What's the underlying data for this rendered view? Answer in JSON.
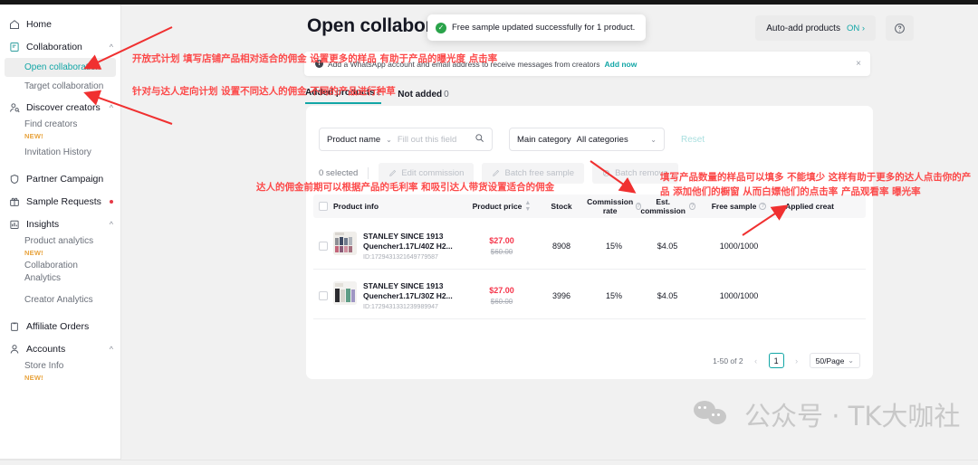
{
  "window": {
    "title": "Open collaboration"
  },
  "sidebar": {
    "items": [
      {
        "label": "Home",
        "icon": "home-icon",
        "type": "top"
      },
      {
        "label": "Collaboration",
        "icon": "collaboration-icon",
        "type": "top",
        "chevron": "^"
      },
      {
        "label": "Open collaboration",
        "type": "sub",
        "active": true
      },
      {
        "label": "Target collaboration",
        "type": "sub"
      },
      {
        "label": "Discover creators",
        "icon": "discover-creators-icon",
        "type": "top",
        "chevron": "^"
      },
      {
        "label": "Find creators",
        "type": "sub",
        "tag": "NEW!"
      },
      {
        "label": "Invitation History",
        "type": "sub"
      },
      {
        "label": "Partner Campaign",
        "icon": "shield-icon",
        "type": "top"
      },
      {
        "label": "Sample Requests",
        "icon": "gift-icon",
        "type": "top",
        "dot": true
      },
      {
        "label": "Insights",
        "icon": "insights-icon",
        "type": "top",
        "chevron": "^"
      },
      {
        "label": "Product analytics",
        "type": "sub",
        "tag": "NEW!"
      },
      {
        "label": "Collaboration Analytics",
        "type": "sub"
      },
      {
        "label": "Creator Analytics",
        "type": "sub"
      },
      {
        "label": "Affiliate Orders",
        "icon": "clipboard-icon",
        "type": "top"
      },
      {
        "label": "Accounts",
        "icon": "account-icon",
        "type": "top",
        "chevron": "^"
      },
      {
        "label": "Store Info",
        "type": "sub",
        "tag": "NEW!"
      }
    ]
  },
  "header": {
    "page_title": "Open collaborat",
    "toast": {
      "message": "Free sample updated successfully for 1 product.",
      "icon": "check-circle-icon"
    },
    "auto_add_label": "Auto-add products",
    "auto_add_state": "ON ›",
    "help_icon": "help-icon"
  },
  "banner": {
    "icon": "info-icon",
    "text": "Add a WhatsApp account and email address to receive messages from creators",
    "link": "Add now",
    "close": "×"
  },
  "tabs": [
    {
      "label": "Added products",
      "count": "2",
      "active": true
    },
    {
      "label": "Not added",
      "count": "0",
      "active": false
    }
  ],
  "filters": {
    "product_name_label": "Product name",
    "product_name_chevron": "⌄",
    "product_name_placeholder": "Fill out this field",
    "search_icon": "search-icon",
    "main_category_label": "Main category",
    "main_category_value": "All categories",
    "main_category_chevron": "⌄",
    "reset_label": "Reset"
  },
  "batch_bar": {
    "selected_label": "0 selected",
    "buttons": [
      {
        "label": "Edit commission",
        "icon": "edit-icon"
      },
      {
        "label": "Batch free sample",
        "icon": "edit-icon"
      },
      {
        "label": "Batch remove",
        "icon": "ban-icon"
      }
    ]
  },
  "table": {
    "columns": [
      {
        "label": "Product info"
      },
      {
        "label": "Product price",
        "sortable": true
      },
      {
        "label": "Stock"
      },
      {
        "label": "Commission rate",
        "info": true
      },
      {
        "label": "Est. commission",
        "info": true
      },
      {
        "label": "Free sample",
        "info": true
      },
      {
        "label": "Applied creat"
      }
    ],
    "rows": [
      {
        "name": "STANLEY SINCE 1913 Quencher1.17L/40Z H2...",
        "id": "ID:1729431321649779587",
        "price": "$27.00",
        "price_old": "$60.00",
        "stock": "8908",
        "commission_rate": "15%",
        "est_commission": "$4.05",
        "free_sample": "1000/1000"
      },
      {
        "name": "STANLEY SINCE 1913 Quencher1.17L/30Z H2...",
        "id": "ID:1729431331239989947",
        "price": "$27.00",
        "price_old": "$60.00",
        "stock": "3996",
        "commission_rate": "15%",
        "est_commission": "$4.05",
        "free_sample": "1000/1000"
      }
    ]
  },
  "pagination": {
    "range": "1-50 of 2",
    "prev": "‹",
    "current_page": "1",
    "next": "›",
    "page_size": "50/Page",
    "page_size_chevron": "⌄"
  },
  "annotations": [
    {
      "id": "anno-open-plan",
      "text": "开放式计划 填写店铺产品相对适合的佣金 设置更多的样品 有助于产品的曝光度 点击率"
    },
    {
      "id": "anno-target-plan",
      "text": "针对与达人定向计划 设置不同达人的佣金 不同的产品进行种草"
    },
    {
      "id": "anno-commission",
      "text": "达人的佣金前期可以根据产品的毛利率 和吸引达人带货设置适合的佣金"
    },
    {
      "id": "anno-free-sample",
      "text": "填写产品数量的样品可以填多 不能填少 这样有助于更多的达人点击你的产品 添加他们的橱窗 从而白嫖他们的点击率 产品观看率 曝光率"
    }
  ],
  "watermark": {
    "text": "公众号 · TK大咖社",
    "icon": "wechat-icon"
  },
  "colors": {
    "accent": "#12a6a6",
    "price": "#f5344a",
    "annotation": "#fc4a4a",
    "new_tag": "#e8a33d",
    "success": "#2aa34a"
  }
}
